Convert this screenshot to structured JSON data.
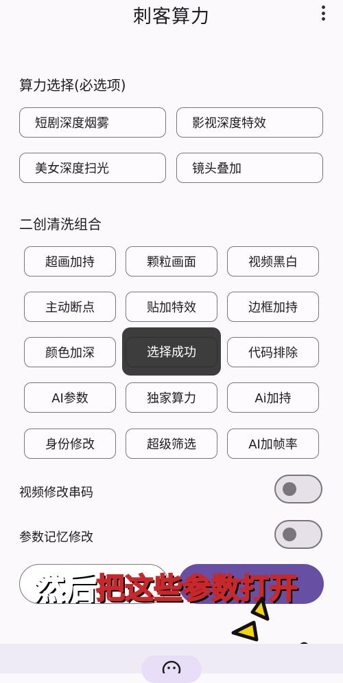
{
  "app": {
    "title": "刺客算力"
  },
  "section1": {
    "title": "算力选择(必选项)",
    "options": [
      "短剧深度烟雾",
      "影视深度特效",
      "美女深度扫光",
      "镜头叠加"
    ]
  },
  "section2": {
    "title": "二创清洗组合",
    "options": [
      "超画加持",
      "颗粒画面",
      "视频黑白",
      "主动断点",
      "贴加特效",
      "边框加持",
      "颜色加深",
      "",
      "代码排除",
      "AI参数",
      "独家算力",
      "Ai加持",
      "身份修改",
      "超级筛选",
      "AI加帧率"
    ]
  },
  "toast": {
    "text": "选择成功"
  },
  "toggles": [
    {
      "label": "视频修改串码",
      "on": false
    },
    {
      "label": "参数记忆修改",
      "on": false
    }
  ],
  "overlay": {
    "red": "然后",
    "white": "把这些参数打开"
  },
  "colors": {
    "accent": "#6750a4",
    "overlay_red": "#e53935",
    "sticker_yellow": "#f5d40f"
  }
}
